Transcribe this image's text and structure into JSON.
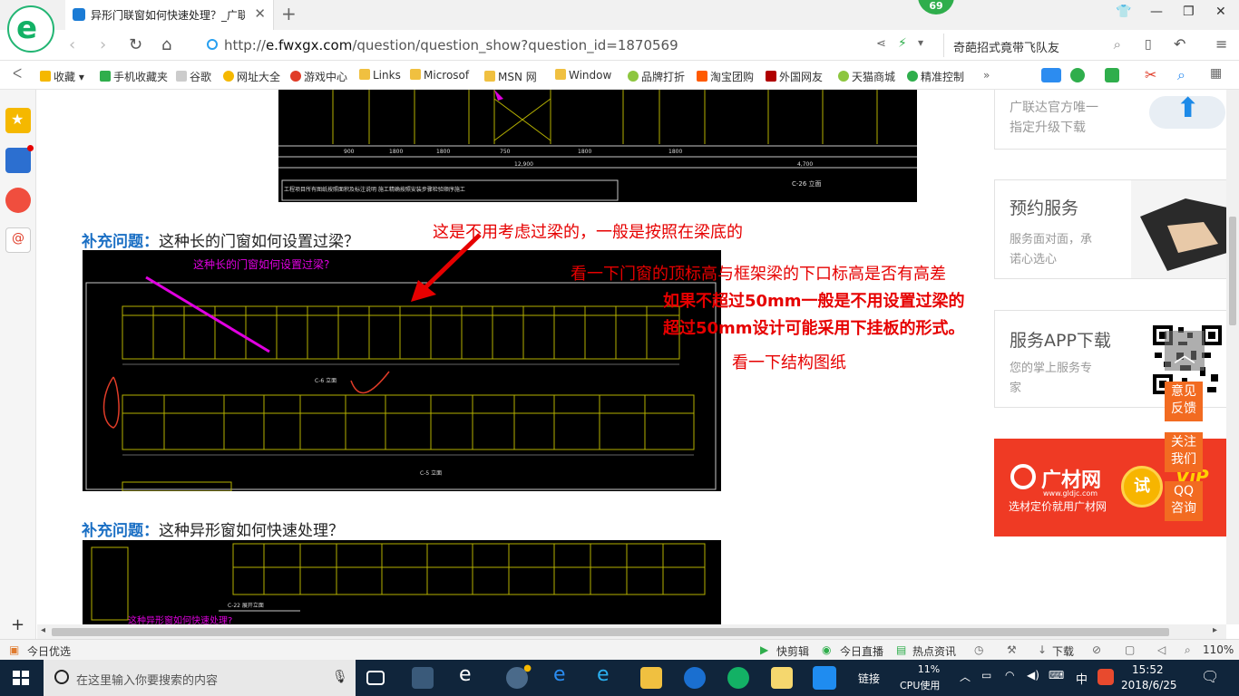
{
  "browser": {
    "tab_title": "异形门联窗如何快速处理？_广联",
    "tab_close": "✕",
    "new_tab": "+",
    "badge": "69",
    "url_prefix": "http://",
    "url_host": "e.fwxgx.com",
    "url_path": "/question/question_show?question_id=1870569",
    "search_text": "奇葩招式竟带飞队友"
  },
  "bookmarks": [
    {
      "label": "收藏",
      "color": "#f5b800"
    },
    {
      "label": "手机收藏夹",
      "color": "#2fae4c"
    },
    {
      "label": "谷歌",
      "color": "#888888"
    },
    {
      "label": "网址大全",
      "color": "#f5b800"
    },
    {
      "label": "游戏中心",
      "color": "#e03c28"
    },
    {
      "label": "Links",
      "color": "#f0c040"
    },
    {
      "label": "Microsof",
      "color": "#f0c040"
    },
    {
      "label": "MSN 网",
      "color": "#f0c040"
    },
    {
      "label": "Window",
      "color": "#f0c040"
    },
    {
      "label": "品牌打折",
      "color": "#8dc63f"
    },
    {
      "label": "淘宝团购",
      "color": "#ff5a00"
    },
    {
      "label": "外国网友",
      "color": "#b00000"
    },
    {
      "label": "天猫商城",
      "color": "#8dc63f"
    },
    {
      "label": "精准控制",
      "color": "#2fae4c"
    }
  ],
  "question": {
    "sup_label": "补充问题：",
    "sup1_text": "这种长的门窗如何设置过梁？",
    "sup2_text": "这种异形窗如何快速处理？",
    "cad_caption_1": "这种长的门窗如何设置过梁?",
    "cad_caption_2": "这种异形窗如何快速处理?",
    "cad_note_top": "工程项目所有图纸按照面积及标注说明 施工精确按照安装步骤检验顺序施工",
    "cad_label_top": "C-26 立面",
    "cad_label_mid": "C-6 立面",
    "cad_label_low": "C-5 立面",
    "cad_label_bottom": "C-22 展开立面"
  },
  "annotations": {
    "a1": "这是不用考虑过梁的，一般是按照在梁底的",
    "a2": "看一下门窗的顶标高与框架梁的下口标高是否有高差",
    "a3": "如果不超过50mm一般是不用设置过梁的",
    "a4": "超过50mm设计可能采用下挂板的形式。",
    "a5": "看一下结构图纸"
  },
  "sidebar_ads": {
    "ad1_line1": "广联达官方唯一",
    "ad1_line2": "指定升级下载",
    "ad2_title": "预约服务",
    "ad2_line1": "服务面对面，承",
    "ad2_line2": "诺心选心",
    "ad3_title": "服务APP下载",
    "ad3_line1": "您的掌上服务专",
    "ad3_line2": "家",
    "banner_brand": "广材网",
    "banner_site": "www.gldjc.com",
    "banner_slogan": "选材定价就用广材网",
    "banner_try": "试",
    "banner_vip": "ViP",
    "float_feedback": "意见反馈",
    "float_follow": "关注我们",
    "float_qq": "QQ咨询"
  },
  "status": {
    "left": "今日优选",
    "items": [
      "快剪辑",
      "今日直播",
      "热点资讯",
      "下载"
    ],
    "zoom": "110%"
  },
  "taskbar": {
    "search_placeholder": "在这里输入你要搜索的内容",
    "link": "链接",
    "cpu_pct": "11%",
    "cpu_label": "CPU使用",
    "ime": "中",
    "time": "15:52",
    "date": "2018/6/25"
  },
  "colors": {
    "accent_blue": "#1a6fc4",
    "annotation_red": "#e60000",
    "brand_green": "#13b165",
    "float_orange": "#f26b21"
  }
}
